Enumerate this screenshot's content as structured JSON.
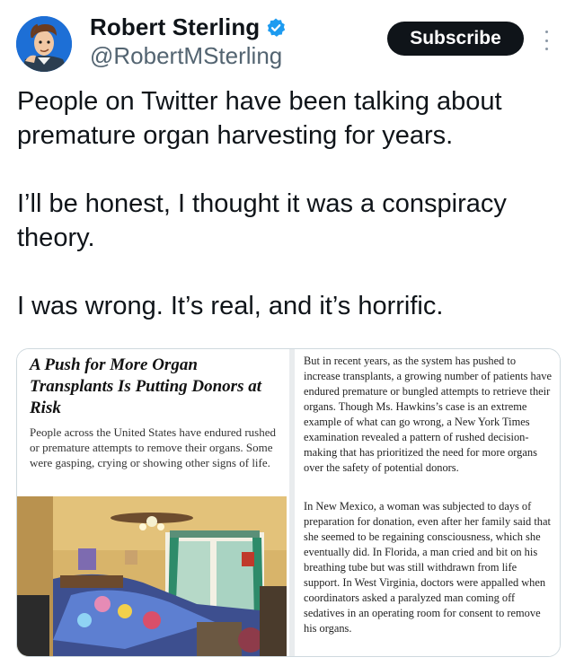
{
  "author": {
    "display_name": "Robert Sterling",
    "handle": "@RobertMSterling",
    "verified": true,
    "avatar_icon": "cartoon-man-avatar-icon"
  },
  "actions": {
    "subscribe_label": "Subscribe",
    "more_icon": "more-vertical-icon"
  },
  "tweet": {
    "paragraphs": [
      "People on Twitter have been talking about premature organ harvesting for years.",
      "I’ll be honest, I thought it was a conspiracy theory.",
      "I was wrong. It’s real, and it’s horrific."
    ]
  },
  "article_card": {
    "headline": "A Push for More Organ Transplants Is Putting Donors at Risk",
    "dek": "People across the United States have endured rushed or premature attempts to remove their organs. Some were gasping, crying or showing other signs of life.",
    "photo_icon": "bedroom-photo-icon",
    "body": [
      "But in recent years, as the system has pushed to increase transplants, a growing number of patients have endured premature or bungled attempts to retrieve their organs. Though Ms. Hawkins’s case is an extreme example of what can go wrong, a New York Times examination revealed a pattern of rushed decision-making that has prioritized the need for more organs over the safety of potential donors.",
      "In New Mexico, a woman was subjected to days of preparation for donation, even after her family said that she seemed to be regaining consciousness, which she eventually did. In Florida, a man cried and bit on his breathing tube but was still withdrawn from life support. In West Virginia, doctors were appalled when coordinators asked a paralyzed man coming off sedatives in an operating room for consent to remove his organs."
    ]
  },
  "colors": {
    "text": "#0f1419",
    "secondary": "#536471",
    "verified_badge": "#1d9bf0",
    "subscribe_bg": "#0f1419"
  }
}
